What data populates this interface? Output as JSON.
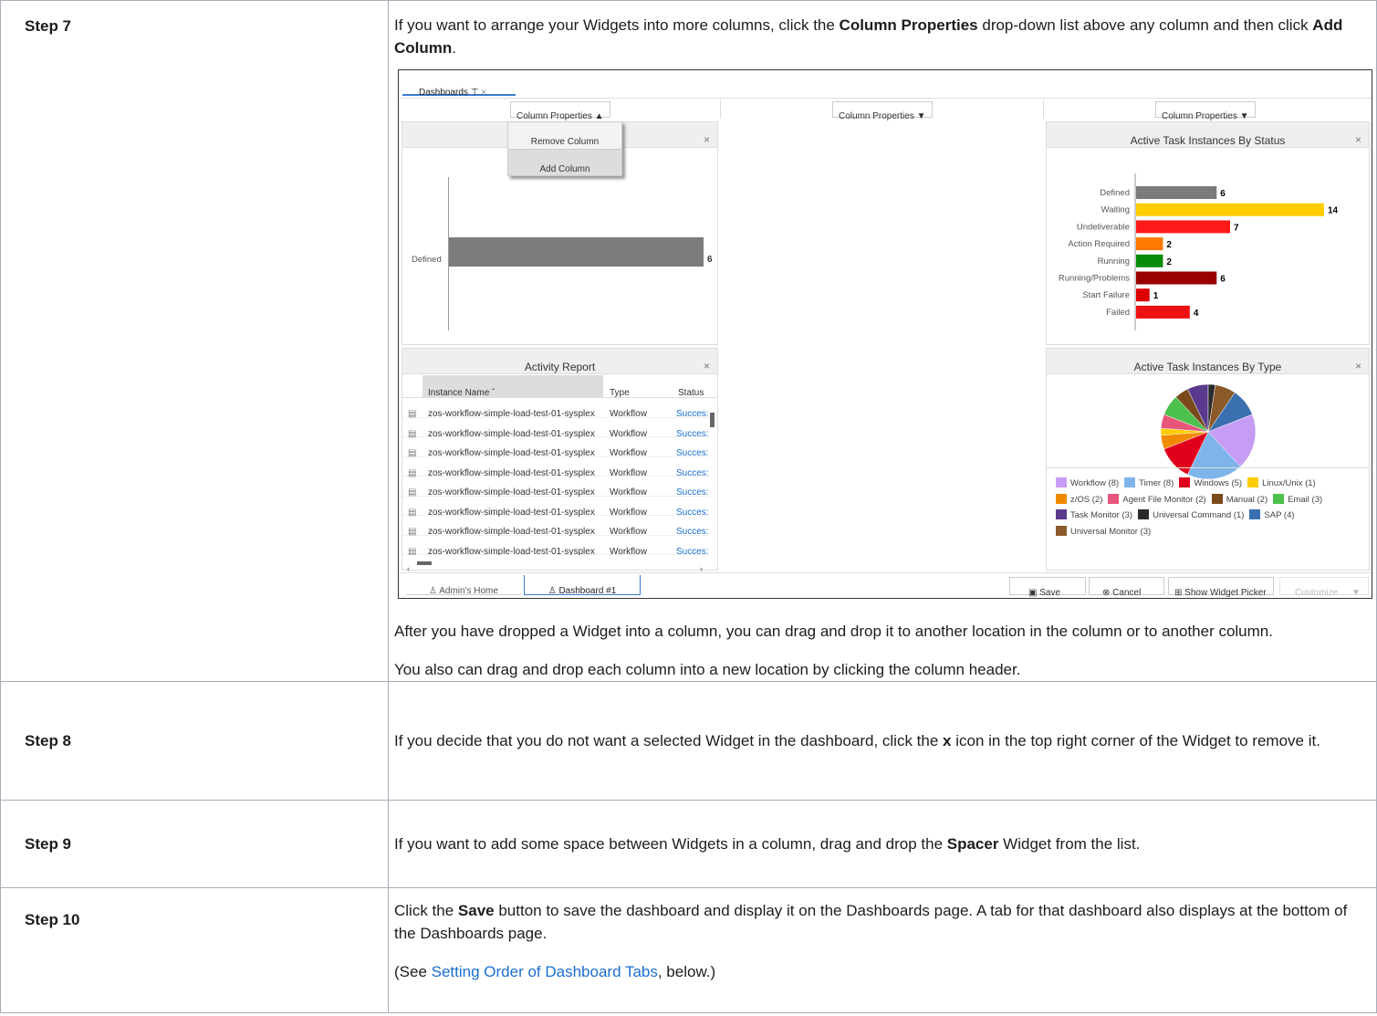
{
  "steps": [
    {
      "label": "Step 7"
    },
    {
      "label": "Step 8"
    },
    {
      "label": "Step 9"
    },
    {
      "label": "Step 10"
    }
  ],
  "step7": {
    "intro_pre": "If you want to arrange your Widgets into more columns, click the ",
    "intro_bold1": "Column Properties",
    "intro_mid": " drop-down list above any column and then click ",
    "intro_bold2": "Add Column",
    "intro_post": ".",
    "para2": "After you have dropped a Widget into a column, you can drag and drop it to another location in the column or to another column.",
    "para3": "You also can drag and drop each column into a new location by clicking the column header."
  },
  "step8": {
    "pre": "If you decide that you do not want a selected Widget in the dashboard, click the ",
    "bold": "x",
    "post": " icon in the top right corner of the Widget to remove it."
  },
  "step9": {
    "pre": "If you want to add some space between Widgets in a column, drag and drop the ",
    "bold": "Spacer",
    "post": " Widget from the list."
  },
  "step10": {
    "pre": "Click the ",
    "bold": "Save",
    "post": " button to save the dashboard and display it on the Dashboards page. A tab for that dashboard also displays at the bottom of the Dashboards page.",
    "see_pre": "(See ",
    "see_link": "Setting Order of Dashboard Tabs",
    "see_post": ", below.)"
  },
  "screenshot": {
    "top_tab": "Dashboards",
    "top_tab_pin": "⊤",
    "top_tab_close": "×",
    "column_properties": "Column Properties",
    "menu": {
      "remove": "Remove Column",
      "add": "Add Column"
    },
    "close": "×",
    "left_chart": {
      "category": "Defined",
      "value": "6"
    },
    "activity": {
      "title": "Activity Report",
      "headers": {
        "name": "Instance Name",
        "type": "Type",
        "status": "Status"
      },
      "rows": [
        {
          "name": "zos-workflow-simple-load-test-01-sysplex",
          "type": "Workflow",
          "status": "Succes:"
        },
        {
          "name": "zos-workflow-simple-load-test-01-sysplex",
          "type": "Workflow",
          "status": "Succes:"
        },
        {
          "name": "zos-workflow-simple-load-test-01-sysplex",
          "type": "Workflow",
          "status": "Succes:"
        },
        {
          "name": "zos-workflow-simple-load-test-01-sysplex",
          "type": "Workflow",
          "status": "Succes:"
        },
        {
          "name": "zos-workflow-simple-load-test-01-sysplex",
          "type": "Workflow",
          "status": "Succes:"
        },
        {
          "name": "zos-workflow-simple-load-test-01-sysplex",
          "type": "Workflow",
          "status": "Succes:"
        },
        {
          "name": "zos-workflow-simple-load-test-01-sysplex",
          "type": "Workflow",
          "status": "Succes:"
        },
        {
          "name": "zos-workflow-simple-load-test-01-sysplex",
          "type": "Workflow",
          "status": "Succes:"
        }
      ]
    },
    "status_chart_title": "Active Task Instances By Status",
    "type_chart_title": "Active Task Instances By Type",
    "bottom_tabs": {
      "home": "Admin's Home",
      "dash": "Dashboard #1"
    },
    "buttons": {
      "save": "Save",
      "cancel": "Cancel",
      "picker": "Show Widget Picker",
      "customize": "Customize"
    }
  },
  "chart_data": [
    {
      "type": "bar",
      "title": "Active Task Instances By Status",
      "categories": [
        "Defined",
        "Waiting",
        "Undeliverable",
        "Action Required",
        "Running",
        "Running/Problems",
        "Start Failure",
        "Failed"
      ],
      "values": [
        6,
        14,
        7,
        2,
        2,
        6,
        1,
        4
      ],
      "colors": [
        "#7b7b7b",
        "#ffcc00",
        "#ff1a1a",
        "#ff7a00",
        "#0a8a0a",
        "#990000",
        "#dd0000",
        "#ee1111"
      ]
    },
    {
      "type": "pie",
      "title": "Active Task Instances By Type",
      "labels": [
        "Workflow (8)",
        "Timer (8)",
        "Windows (5)",
        "Linux/Unix (1)",
        "z/OS (2)",
        "Agent File Monitor (2)",
        "Manual (2)",
        "Email (3)",
        "Task Monitor (3)",
        "Universal Command (1)",
        "SAP (4)",
        "Universal Monitor (3)"
      ],
      "values": [
        8,
        8,
        5,
        1,
        2,
        2,
        2,
        3,
        3,
        1,
        4,
        3
      ],
      "colors": [
        "#c79cf5",
        "#7fb4ea",
        "#e0001b",
        "#ffcc00",
        "#f08a00",
        "#e8557a",
        "#7a4a1a",
        "#4cc04c",
        "#5a3a8c",
        "#2a2a2a",
        "#3a6fb0",
        "#8a5a2a"
      ]
    }
  ]
}
